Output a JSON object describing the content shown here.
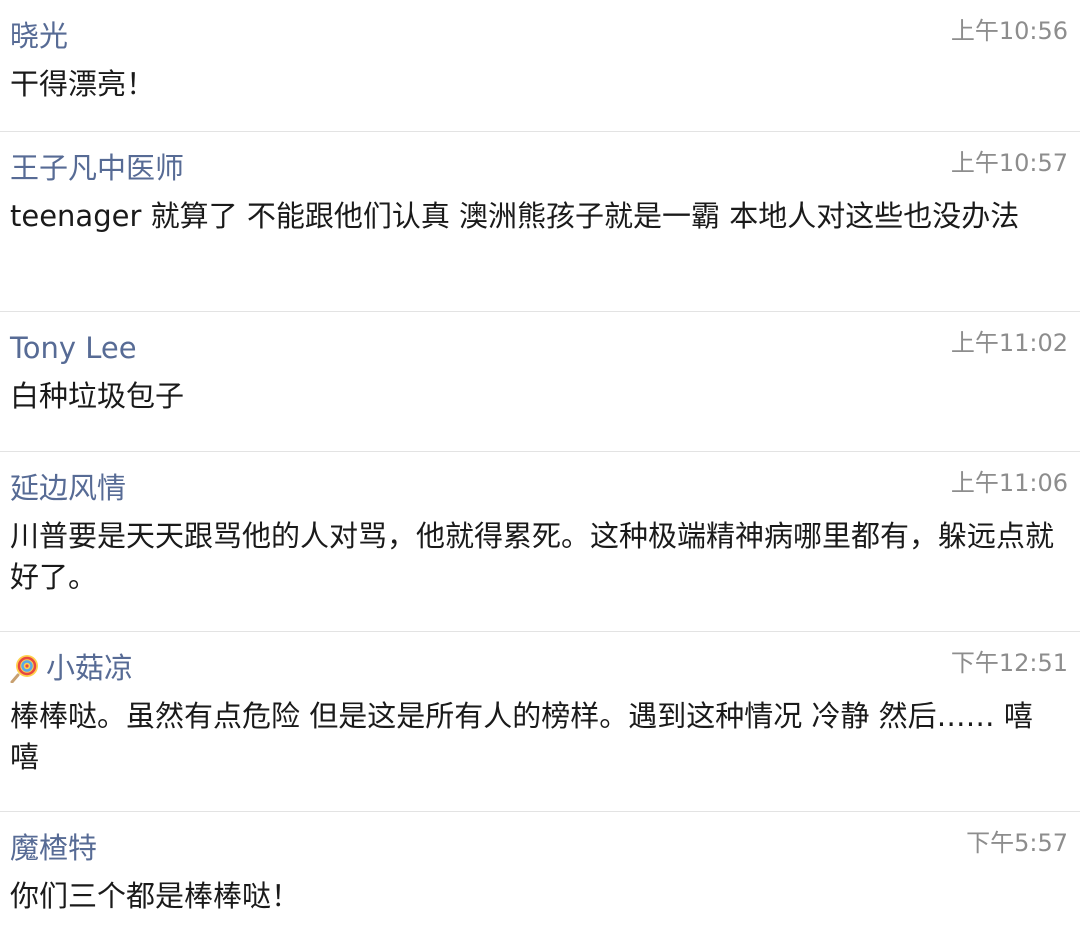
{
  "comments": [
    {
      "name": "晓光",
      "time": "上午10:56",
      "text": "干得漂亮！"
    },
    {
      "name": "王子凡中医师",
      "time": "上午10:57",
      "text": "teenager 就算了  不能跟他们认真 澳洲熊孩子就是一霸  本地人对这些也没办法"
    },
    {
      "name": "Tony Lee",
      "time": "上午11:02",
      "text": "白种垃圾包子"
    },
    {
      "name": "延边风情",
      "time": "上午11:06",
      "text": "川普要是天天跟骂他的人对骂，他就得累死。这种极端精神病哪里都有，躲远点就好了。"
    },
    {
      "name": "小菇凉",
      "time": "下午12:51",
      "text": "棒棒哒。虽然有点危险 但是这是所有人的榜样。遇到这种情况 冷静 然后…… 嘻嘻",
      "icon": "lollipop-icon"
    },
    {
      "name": "魔楂特",
      "time": "下午5:57",
      "text": "你们三个都是棒棒哒！"
    }
  ],
  "colors": {
    "name": "#576b95",
    "time": "#8d8d8d",
    "text": "#1a1a1a",
    "divider": "#e3e3e3"
  }
}
